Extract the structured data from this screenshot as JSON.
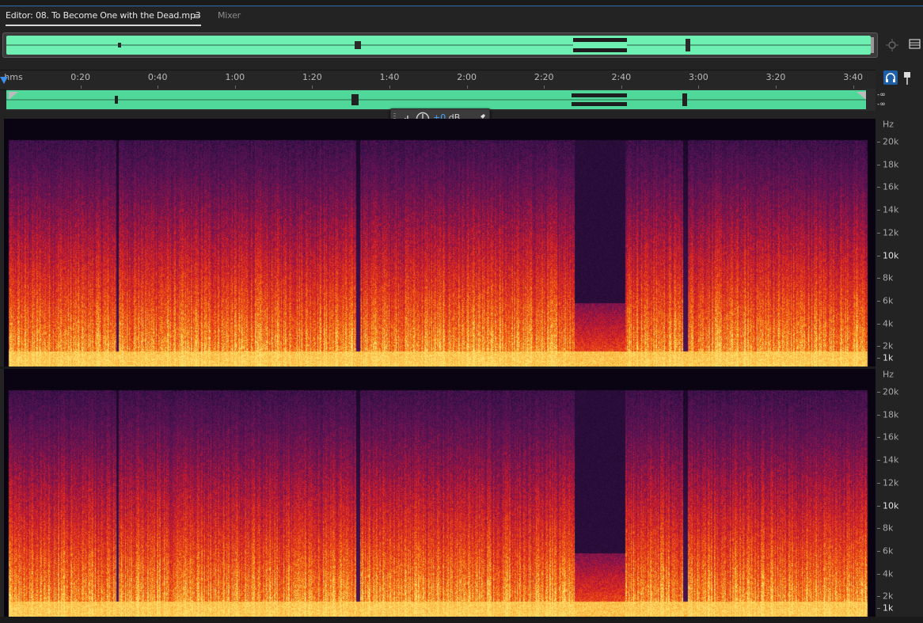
{
  "tabs": {
    "editor_label": "Editor: 08. To Become One with the Dead.mp3",
    "menu_glyph": "≡",
    "mixer_label": "Mixer"
  },
  "timeline": {
    "unit_label": "hms",
    "ticks": [
      {
        "label": "0:20",
        "seconds": 20
      },
      {
        "label": "0:40",
        "seconds": 40
      },
      {
        "label": "1:00",
        "seconds": 60
      },
      {
        "label": "1:20",
        "seconds": 80
      },
      {
        "label": "1:40",
        "seconds": 100
      },
      {
        "label": "2:00",
        "seconds": 120
      },
      {
        "label": "2:20",
        "seconds": 140
      },
      {
        "label": "2:40",
        "seconds": 160
      },
      {
        "label": "3:00",
        "seconds": 180
      },
      {
        "label": "3:20",
        "seconds": 200
      },
      {
        "label": "3:40",
        "seconds": 220
      }
    ]
  },
  "meter": {
    "left": "-∞",
    "right": "-∞"
  },
  "gain_hud": {
    "value": "+0",
    "unit": "dB"
  },
  "frequency_scale": {
    "unit": "Hz",
    "labels": [
      {
        "label": "20k",
        "hz": 20000,
        "bold": false
      },
      {
        "label": "18k",
        "hz": 18000,
        "bold": false
      },
      {
        "label": "16k",
        "hz": 16000,
        "bold": false
      },
      {
        "label": "14k",
        "hz": 14000,
        "bold": false
      },
      {
        "label": "12k",
        "hz": 12000,
        "bold": false
      },
      {
        "label": "10k",
        "hz": 10000,
        "bold": true
      },
      {
        "label": "8k",
        "hz": 8000,
        "bold": false
      },
      {
        "label": "6k",
        "hz": 6000,
        "bold": false
      },
      {
        "label": "4k",
        "hz": 4000,
        "bold": false
      },
      {
        "label": "2k",
        "hz": 2000,
        "bold": false
      },
      {
        "label": "1k",
        "hz": 1000,
        "bold": true
      }
    ]
  },
  "colors": {
    "waveform": "#6df0b2",
    "accent": "#3d8ee8",
    "spectrum_low": "#ffd060",
    "spectrum_mid": "#e8301e",
    "spectrum_high": "#4a1a5a"
  }
}
